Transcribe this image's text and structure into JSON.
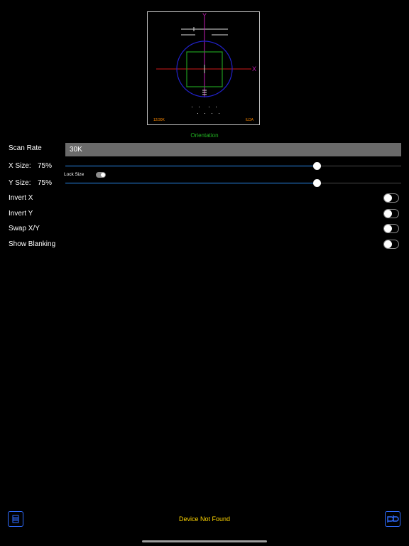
{
  "preview": {
    "corner_left": "12/30K",
    "corner_right": "ILDA",
    "caption": "Orientation"
  },
  "scan_rate": {
    "label": "Scan Rate",
    "value": "30K"
  },
  "x_size": {
    "label": "X Size:",
    "value_text": "75%",
    "fraction": 0.75
  },
  "y_size": {
    "label": "Y Size:",
    "value_text": "75%",
    "fraction": 0.75
  },
  "lock_size": {
    "label": "Lock Size",
    "on": true
  },
  "toggles": [
    {
      "label": "Invert X",
      "on": false
    },
    {
      "label": "Invert Y",
      "on": false
    },
    {
      "label": "Swap X/Y",
      "on": false
    },
    {
      "label": "Show Blanking",
      "on": false
    }
  ],
  "status": "Device Not Found",
  "colors": {
    "accent": "#2a8cf0",
    "status": "#ffd600",
    "caption": "#22b322",
    "axis_x": "#d11a1a",
    "axis_y": "#c21db5",
    "circle": "#2222cc",
    "square": "#1e9b1e",
    "corner_text": "#ff8a00"
  },
  "icons": {
    "left_button": "laser-settings-icon",
    "right_button": "pb-logo-icon"
  }
}
